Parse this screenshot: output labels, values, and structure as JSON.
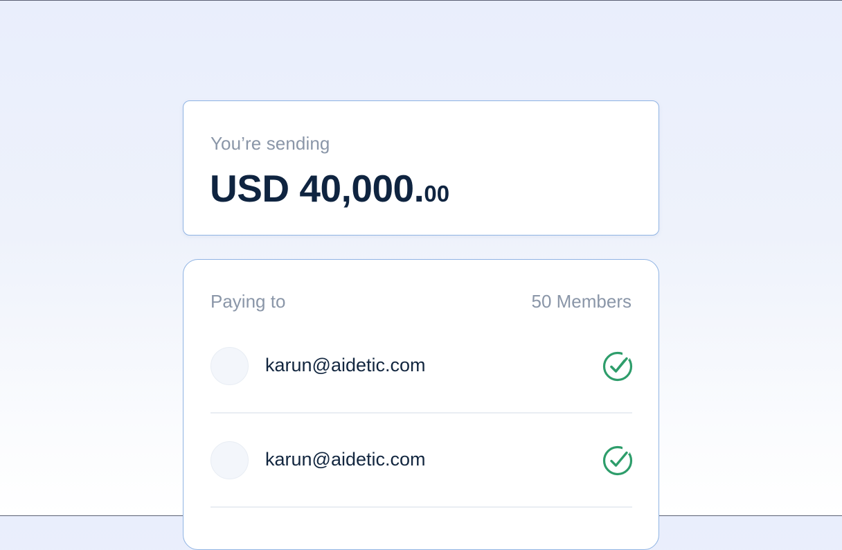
{
  "sending": {
    "label": "You’re sending",
    "amount_main": "USD 40,000.",
    "amount_cents": "00"
  },
  "paying": {
    "label": "Paying to",
    "count": "50 Members",
    "members": [
      {
        "email": "karun@aidetic.com",
        "status_icon": "check-circle-icon"
      },
      {
        "email": "karun@aidetic.com",
        "status_icon": "check-circle-icon"
      }
    ]
  },
  "colors": {
    "accent_border": "#8fb3e3",
    "success": "#2e9d6b",
    "muted_text": "#8a96a8",
    "primary_text": "#0f2440"
  }
}
